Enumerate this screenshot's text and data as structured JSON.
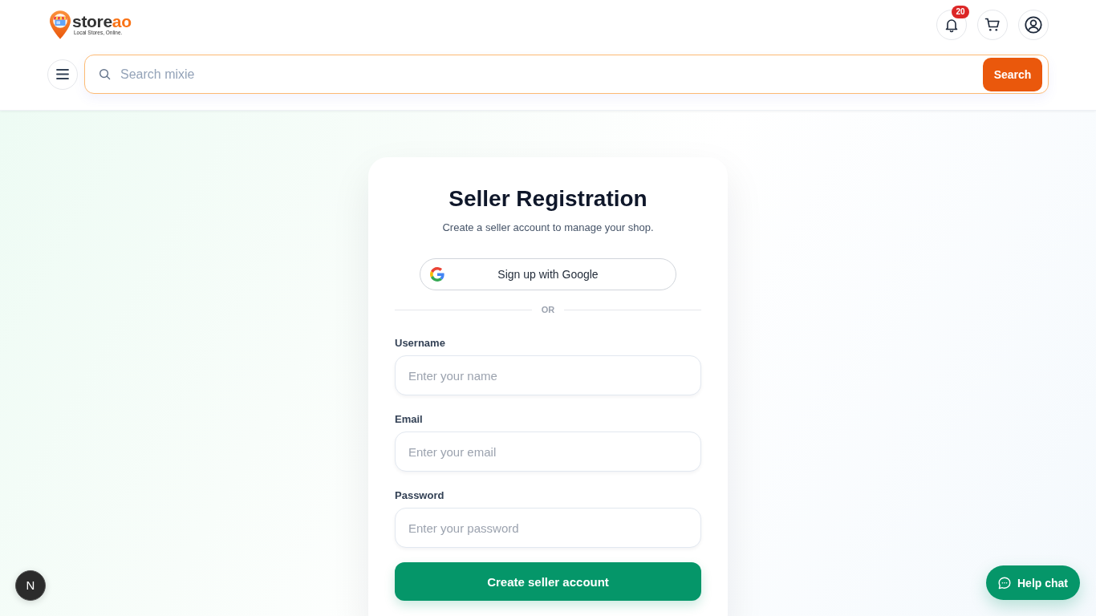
{
  "header": {
    "logo": {
      "name": "store",
      "name_accent": "ao",
      "tagline": "Local Stores, Online."
    },
    "notifications": {
      "count": "20"
    },
    "search": {
      "placeholder": "Search mixie",
      "button": "Search"
    }
  },
  "registration": {
    "title": "Seller Registration",
    "subtitle": "Create a seller account to manage your shop.",
    "google_button": "Sign up with Google",
    "divider": "OR",
    "fields": [
      {
        "label": "Username",
        "placeholder": "Enter your name"
      },
      {
        "label": "Email",
        "placeholder": "Enter your email"
      },
      {
        "label": "Password",
        "placeholder": "Enter your password"
      }
    ],
    "submit": "Create seller account"
  },
  "dev_indicator": {
    "letter": "N"
  },
  "help_chat": {
    "label": "Help chat"
  }
}
